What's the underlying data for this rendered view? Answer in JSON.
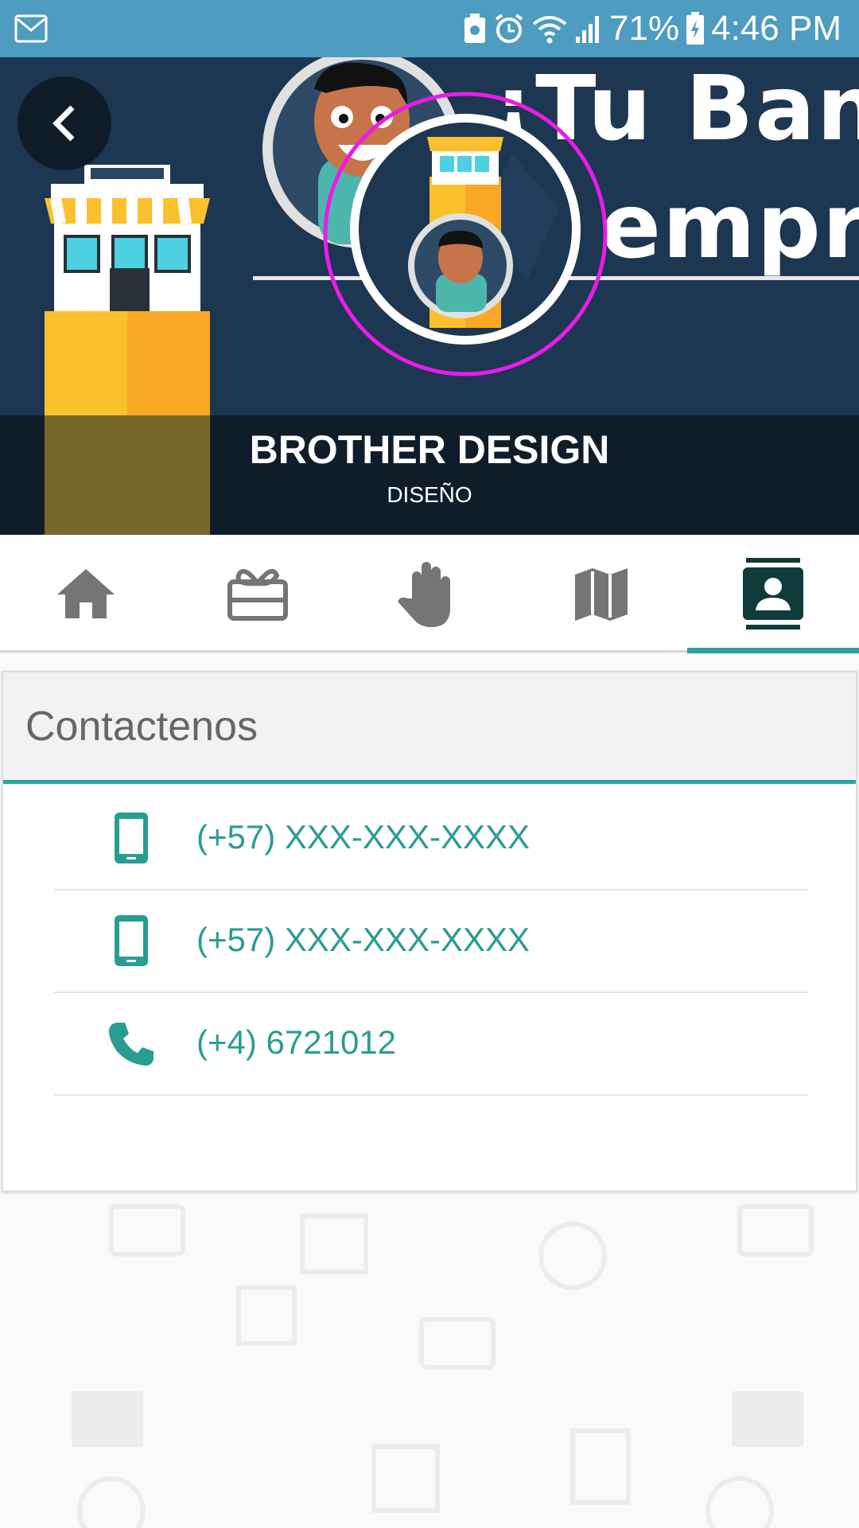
{
  "status_bar": {
    "battery": "71%",
    "time": "4:46 PM"
  },
  "banner": {
    "headline_line1": "¡Tu Banne",
    "headline_line2": "empre",
    "company_name": "BROTHER DESIGN",
    "company_category": "DISEÑO"
  },
  "tabs": [
    {
      "name": "home",
      "icon": "home-icon",
      "active": false
    },
    {
      "name": "offers",
      "icon": "gift-card-icon",
      "active": false
    },
    {
      "name": "services",
      "icon": "hand-icon",
      "active": false
    },
    {
      "name": "map",
      "icon": "map-icon",
      "active": false
    },
    {
      "name": "contact",
      "icon": "contact-card-icon",
      "active": true
    }
  ],
  "contact": {
    "title": "Contactenos",
    "items": [
      {
        "type": "mobile",
        "icon": "smartphone-icon",
        "text": "(+57) XXX-XXX-XXXX"
      },
      {
        "type": "mobile",
        "icon": "smartphone-icon",
        "text": "(+57) XXX-XXX-XXXX"
      },
      {
        "type": "landline",
        "icon": "phone-icon",
        "text": "(+4) 6721012"
      }
    ]
  },
  "colors": {
    "status_bar": "#4e9cc0",
    "accent": "#26a69a",
    "banner_bg": "#1d3651",
    "highlight_ring": "#e81ce8"
  }
}
